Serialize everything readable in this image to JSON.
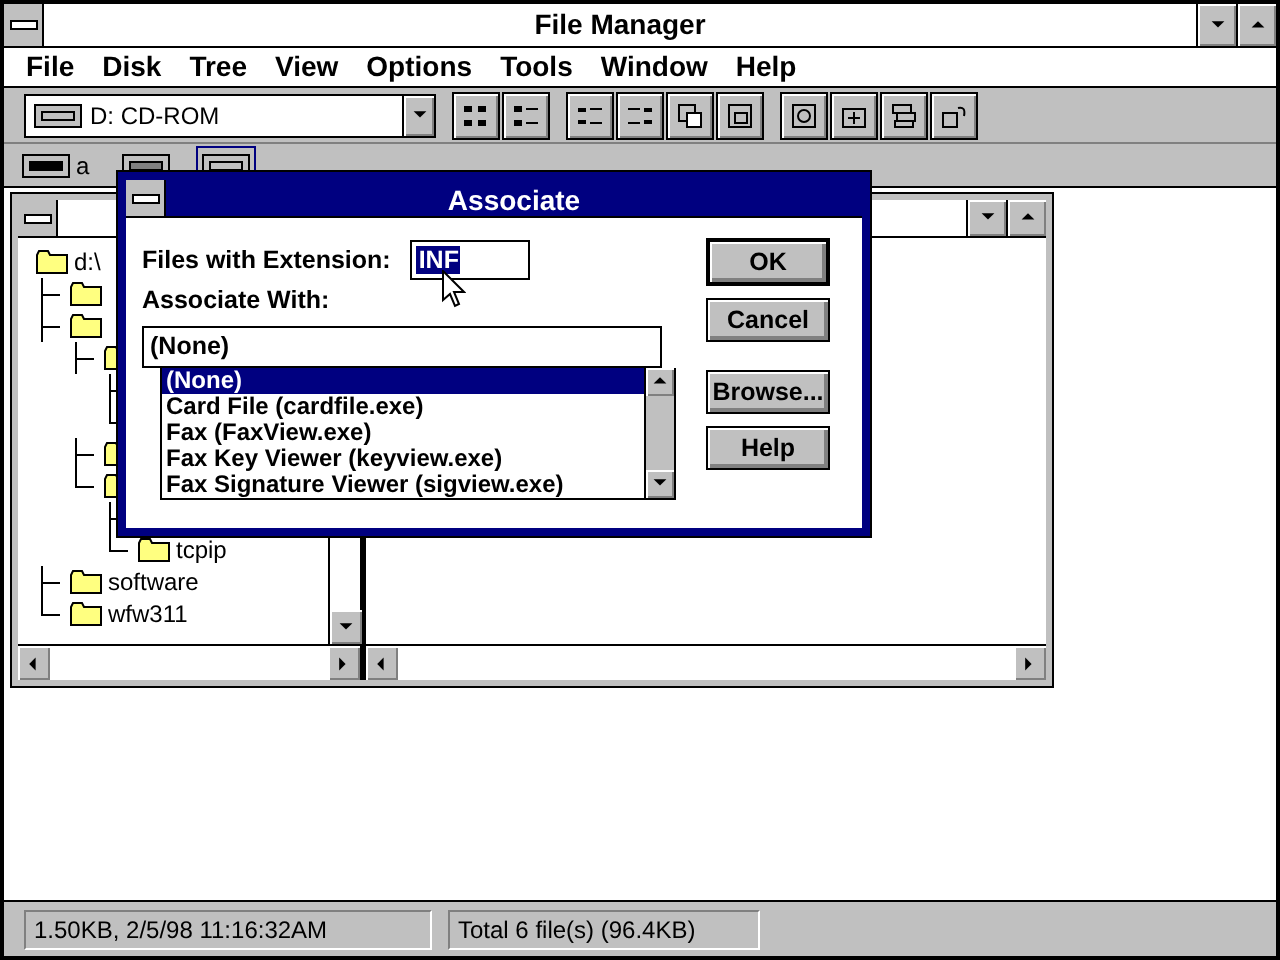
{
  "window": {
    "title": "File Manager"
  },
  "menu": [
    "File",
    "Disk",
    "Tree",
    "View",
    "Options",
    "Tools",
    "Window",
    "Help"
  ],
  "toolbar": {
    "drive_select": {
      "value": "D: CD-ROM"
    }
  },
  "drives": [
    {
      "letter": "a",
      "kind": "floppy",
      "selected": false
    },
    {
      "kind": "hard",
      "selected": false
    },
    {
      "kind": "cdrom",
      "selected": true
    }
  ],
  "tree": [
    {
      "kind": "folder",
      "label": "d:\\",
      "children": [
        {
          "kind": "folder"
        },
        {
          "kind": "folder",
          "children": [
            {
              "kind": "folder",
              "children": [
                {
                  "kind": "branch"
                },
                {
                  "kind": "branch"
                }
              ]
            },
            {
              "kind": "folder"
            },
            {
              "kind": "folder",
              "children": [
                {
                  "kind": "branch"
                },
                {
                  "kind": "folder",
                  "label": "tcpip"
                }
              ]
            }
          ]
        },
        {
          "kind": "folder",
          "label": "software"
        },
        {
          "kind": "folder",
          "label": "wfw311"
        }
      ]
    }
  ],
  "dialog": {
    "title": "Associate",
    "extension_label": "Files with Extension:",
    "extension_value": "INF",
    "associate_label": "Associate With:",
    "associate_value": "(None)",
    "options": [
      {
        "label": "(None)",
        "selected": true
      },
      {
        "label": "Card File (cardfile.exe)",
        "selected": false
      },
      {
        "label": "Fax (FaxView.exe)",
        "selected": false
      },
      {
        "label": "Fax Key Viewer (keyview.exe)",
        "selected": false
      },
      {
        "label": "Fax Signature Viewer (sigview.exe)",
        "selected": false
      }
    ],
    "buttons": [
      {
        "label": "OK",
        "default": true
      },
      {
        "label": "Cancel",
        "default": false
      },
      {
        "label": "Browse...",
        "default": false
      },
      {
        "label": "Help",
        "default": false
      }
    ]
  },
  "status_bar": [
    "1.50KB, 2/5/98 11:16:32AM",
    "Total 6 file(s) (96.4KB)"
  ]
}
